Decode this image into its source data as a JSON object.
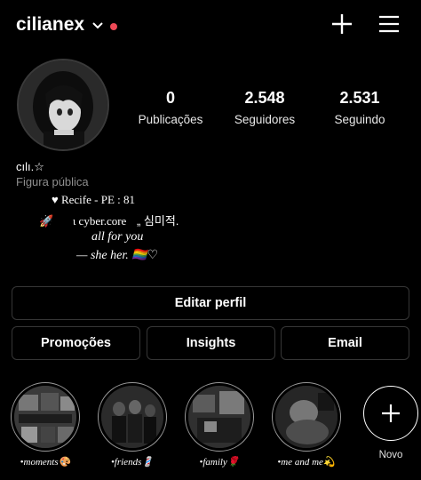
{
  "header": {
    "username": "cilianex",
    "chevron_icon": "chevron-down-icon",
    "notification_color": "#ed4956",
    "create_icon": "plus-icon",
    "menu_icon": "hamburger-menu-icon"
  },
  "profile": {
    "stats": [
      {
        "value": "0",
        "label": "Publicações"
      },
      {
        "value": "2.548",
        "label": "Seguidores"
      },
      {
        "value": "2.531",
        "label": "Seguindo"
      }
    ],
    "name": "cılı.☆",
    "category": "Figura pública",
    "bio": {
      "line1": "♥ Recife - PE : 81",
      "line2_a": "🚀",
      "line2_b": "ι cyber.core",
      "line2_c": "„ 심미적.",
      "line3": "all for you",
      "line4": "— she her. 🏳️‍🌈♡"
    }
  },
  "buttons": {
    "edit_profile": "Editar perfil",
    "promotions": "Promoções",
    "insights": "Insights",
    "email": "Email"
  },
  "highlights": [
    {
      "caption": "•moments🎨"
    },
    {
      "caption": "•friends💈"
    },
    {
      "caption": "•family🌹"
    },
    {
      "caption": "•me and me💫"
    }
  ],
  "new_highlight": {
    "label": "Novo"
  }
}
